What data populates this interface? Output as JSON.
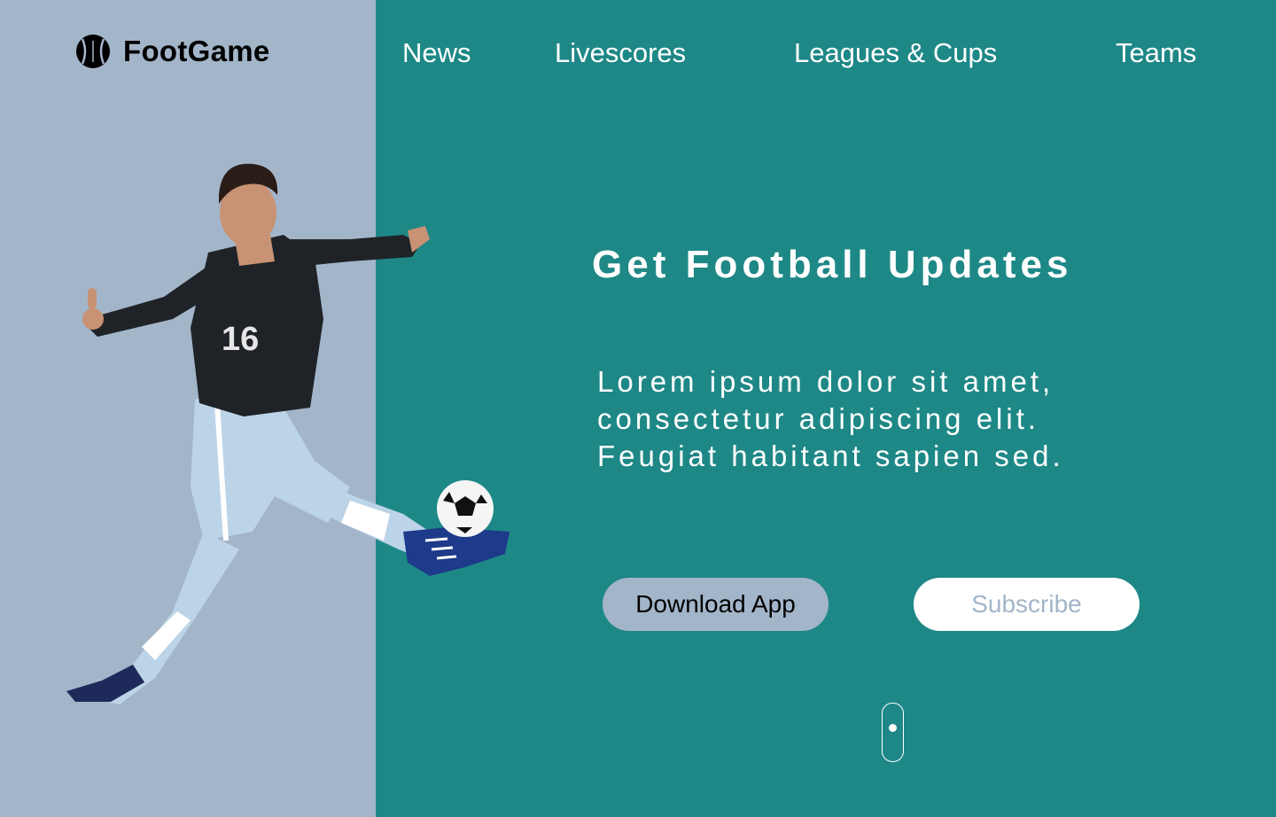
{
  "brand": {
    "name": "FootGame",
    "icon": "football-icon"
  },
  "nav": {
    "items": [
      {
        "label": "News"
      },
      {
        "label": "Livescores"
      },
      {
        "label": "Leagues & Cups"
      },
      {
        "label": "Teams"
      }
    ]
  },
  "hero": {
    "title": "Get Football Updates",
    "lines": [
      "Lorem ipsum dolor sit amet,",
      "consectetur adipiscing elit.",
      "Feugiat habitant sapien sed."
    ],
    "download_label": "Download App",
    "subscribe_label": "Subscribe",
    "player_image": "football-player-kicking-ball",
    "jersey_number": "16"
  },
  "scroll": {
    "icon": "scroll-mouse-icon"
  },
  "colors": {
    "left_panel": "#a3b5c9",
    "right_panel": "#1e8887",
    "text_light": "#ffffff",
    "text_dark": "#000000"
  }
}
